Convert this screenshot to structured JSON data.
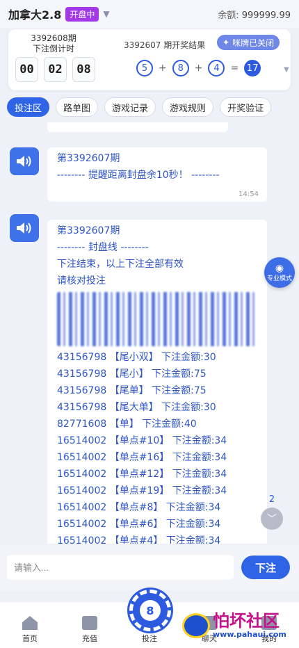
{
  "header": {
    "title": "加拿大2.8",
    "status": "开盘中",
    "balance_label": "余额:",
    "balance_value": "999999.99"
  },
  "card": {
    "current_period": "3392608期",
    "countdown_label": "下注倒计时",
    "countdown": [
      "00",
      "02",
      "08"
    ],
    "last_result_title": "3392607 期开奖结果",
    "closed_label": "咪牌已关闭",
    "balls": [
      "5",
      "8",
      "4"
    ],
    "plus": "+",
    "equals": "=",
    "sum": "17"
  },
  "tabs": [
    {
      "label": "投注区",
      "active": true
    },
    {
      "label": "路单图",
      "active": false
    },
    {
      "label": "游戏记录",
      "active": false
    },
    {
      "label": "游戏规则",
      "active": false
    },
    {
      "label": "开奖验证",
      "active": false
    }
  ],
  "messages": [
    {
      "period": "第3392607期",
      "text": "-------- 提醒距离封盘余10秒！ --------",
      "time": "14:54"
    },
    {
      "period": "第3392607期",
      "line1": "-------- 封盘线 --------",
      "line2": "下注结束，以上下注全部有效",
      "line3": "请核对投注",
      "bets": [
        "43156798 【尾小双】 下注金额:30",
        "43156798 【尾小】 下注金额:75",
        "43156798 【尾单】 下注金额:75",
        "43156798 【尾大单】 下注金额:30",
        "82771608 【单】 下注金额:40",
        "16514002 【单点#10】 下注金额:34",
        "16514002 【单点#16】 下注金额:34",
        "16514002 【单点#12】 下注金额:34",
        "16514002 【单点#19】 下注金额:34",
        "16514002 【单点#8】 下注金额:34",
        "16514002 【单点#6】 下注金额:34",
        "16514002 【单点#4】 下注金额:34"
      ]
    }
  ],
  "floating": {
    "mode_label": "专业模式",
    "unread_count": "2"
  },
  "input": {
    "placeholder": "请输入...",
    "send_label": "下注"
  },
  "nav": {
    "home": "首页",
    "recharge": "充值",
    "bet": "投注",
    "chat": "聊天",
    "mine": "我的"
  },
  "watermark": {
    "text": "怕坏社区",
    "url": "www.pahaui.com"
  }
}
